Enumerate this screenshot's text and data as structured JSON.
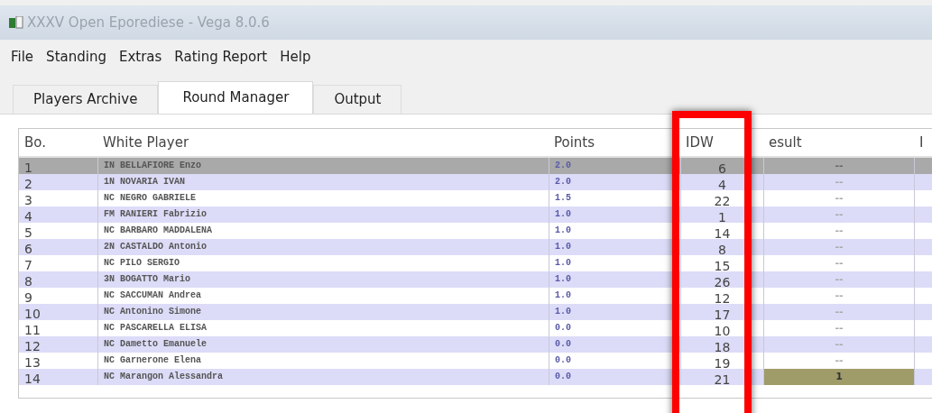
{
  "window": {
    "title": "XXXV Open Eporediese - Vega 8.0.6"
  },
  "menu": [
    "File",
    "Standing",
    "Extras",
    "Rating Report",
    "Help"
  ],
  "tabs": [
    {
      "label": "Players Archive",
      "selected": false
    },
    {
      "label": "Round Manager",
      "selected": true
    },
    {
      "label": "Output",
      "selected": false
    }
  ],
  "table": {
    "columns": [
      "Bo.",
      "White Player",
      "Points",
      "IDW",
      "esult",
      "I"
    ],
    "rows": [
      {
        "board": "1",
        "white": "IN BELLAFIORE Enzo",
        "points": "2.0",
        "idw": "6",
        "result": "--",
        "selected": true,
        "result_focused": false
      },
      {
        "board": "2",
        "white": "1N NOVARIA IVAN",
        "points": "2.0",
        "idw": "4",
        "result": "--",
        "selected": false,
        "result_focused": false
      },
      {
        "board": "3",
        "white": "NC NEGRO GABRIELE",
        "points": "1.5",
        "idw": "22",
        "result": "--",
        "selected": false,
        "result_focused": false
      },
      {
        "board": "4",
        "white": "FM RANIERI Fabrizio",
        "points": "1.0",
        "idw": "1",
        "result": "--",
        "selected": false,
        "result_focused": false
      },
      {
        "board": "5",
        "white": "NC BARBARO MADDALENA",
        "points": "1.0",
        "idw": "14",
        "result": "--",
        "selected": false,
        "result_focused": false
      },
      {
        "board": "6",
        "white": "2N CASTALDO Antonio",
        "points": "1.0",
        "idw": "8",
        "result": "--",
        "selected": false,
        "result_focused": false
      },
      {
        "board": "7",
        "white": "NC PILO SERGIO",
        "points": "1.0",
        "idw": "15",
        "result": "--",
        "selected": false,
        "result_focused": false
      },
      {
        "board": "8",
        "white": "3N BOGATTO Mario",
        "points": "1.0",
        "idw": "26",
        "result": "--",
        "selected": false,
        "result_focused": false
      },
      {
        "board": "9",
        "white": "NC SACCUMAN Andrea",
        "points": "1.0",
        "idw": "12",
        "result": "--",
        "selected": false,
        "result_focused": false
      },
      {
        "board": "10",
        "white": "NC Antonino Simone",
        "points": "1.0",
        "idw": "17",
        "result": "--",
        "selected": false,
        "result_focused": false
      },
      {
        "board": "11",
        "white": "NC PASCARELLA ELISA",
        "points": "0.0",
        "idw": "10",
        "result": "--",
        "selected": false,
        "result_focused": false
      },
      {
        "board": "12",
        "white": "NC Dametto Emanuele",
        "points": "0.0",
        "idw": "18",
        "result": "--",
        "selected": false,
        "result_focused": false
      },
      {
        "board": "13",
        "white": "NC Garnerone Elena",
        "points": "0.0",
        "idw": "19",
        "result": "--",
        "selected": false,
        "result_focused": false
      },
      {
        "board": "14",
        "white": "NC Marangon Alessandra",
        "points": "0.0",
        "idw": "21",
        "result": "1",
        "selected": false,
        "result_focused": true
      }
    ]
  }
}
